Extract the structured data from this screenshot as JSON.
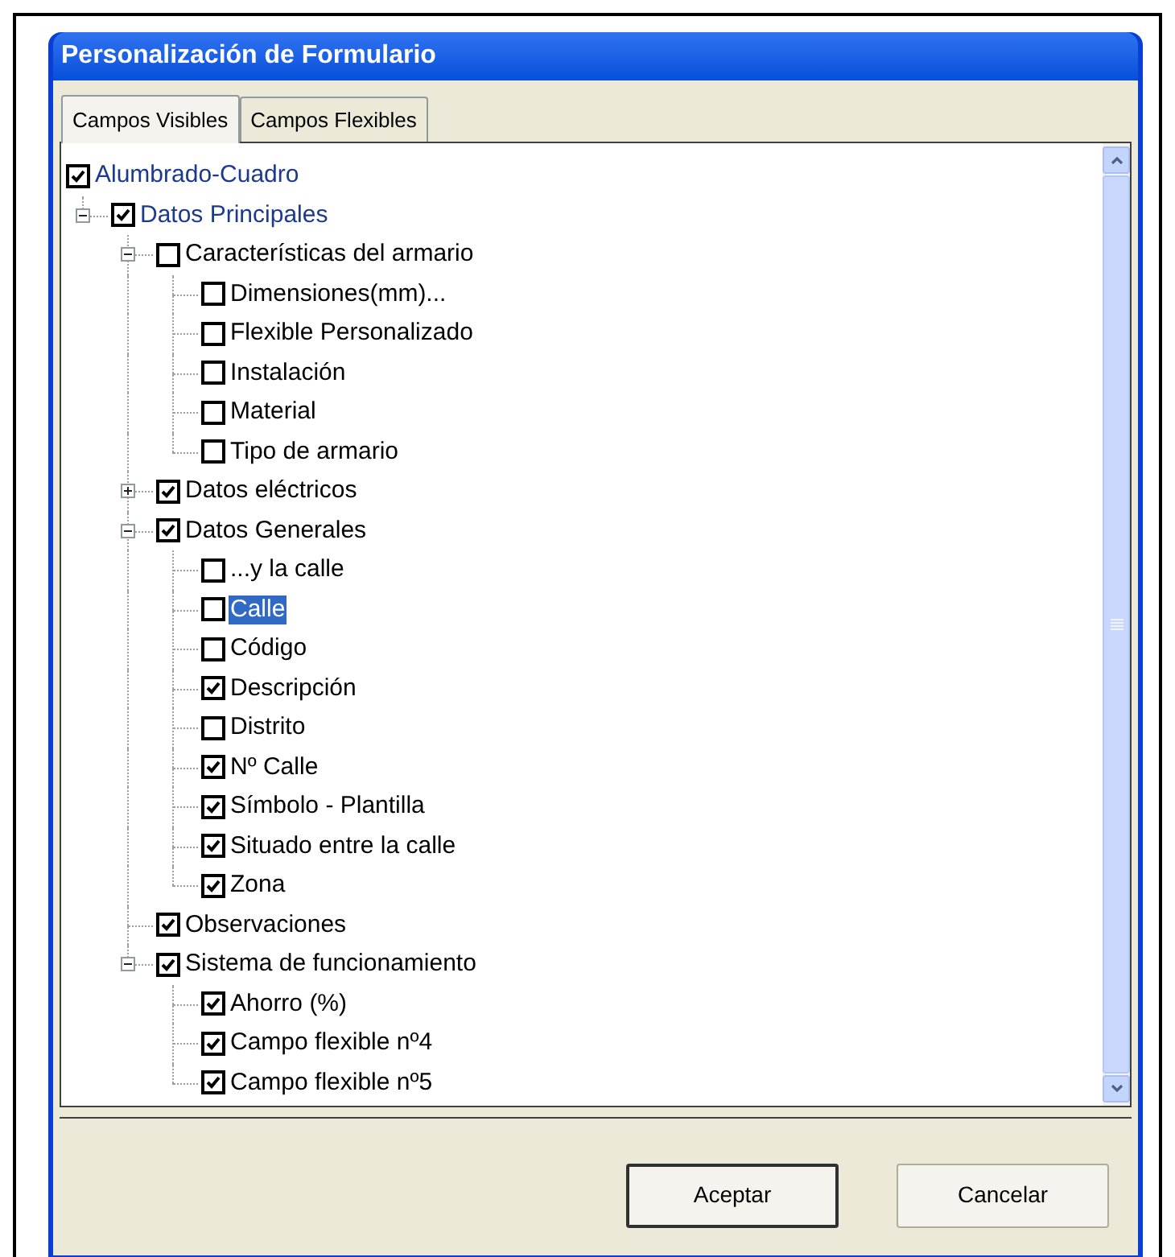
{
  "window": {
    "title": "Personalización de Formulario"
  },
  "tabs": [
    {
      "label": "Campos Visibles",
      "selected": true
    },
    {
      "label": "Campos Flexibles",
      "selected": false
    }
  ],
  "tree": [
    {
      "label": "Alumbrado-Cuadro",
      "checked": true,
      "selected": false,
      "color": "#1c3a8c",
      "children": [
        {
          "label": "Datos Principales",
          "checked": true,
          "selected": false,
          "color": "#1c3a8c",
          "expanded": true,
          "children": [
            {
              "label": "Características del armario",
              "checked": false,
              "selected": false,
              "color": "#000000",
              "expanded": true,
              "children": [
                {
                  "label": "Dimensiones(mm)...",
                  "checked": false,
                  "selected": false,
                  "color": "#000000"
                },
                {
                  "label": "Flexible Personalizado",
                  "checked": false,
                  "selected": false,
                  "color": "#000000"
                },
                {
                  "label": "Instalación",
                  "checked": false,
                  "selected": false,
                  "color": "#000000"
                },
                {
                  "label": "Material",
                  "checked": false,
                  "selected": false,
                  "color": "#000000"
                },
                {
                  "label": "Tipo de armario",
                  "checked": false,
                  "selected": false,
                  "color": "#000000"
                }
              ]
            },
            {
              "label": "Datos eléctricos",
              "checked": true,
              "selected": false,
              "color": "#000000",
              "expanded": false
            },
            {
              "label": "Datos Generales",
              "checked": true,
              "selected": false,
              "color": "#000000",
              "expanded": true,
              "children": [
                {
                  "label": "...y la calle",
                  "checked": false,
                  "selected": false,
                  "color": "#000000"
                },
                {
                  "label": "Calle",
                  "checked": false,
                  "selected": true
                },
                {
                  "label": "Código",
                  "checked": false,
                  "selected": false,
                  "color": "#000000"
                },
                {
                  "label": "Descripción",
                  "checked": true,
                  "selected": false,
                  "color": "#000000"
                },
                {
                  "label": "Distrito",
                  "checked": false,
                  "selected": false,
                  "color": "#000000"
                },
                {
                  "label": "Nº Calle",
                  "checked": true,
                  "selected": false,
                  "color": "#000000"
                },
                {
                  "label": "Símbolo - Plantilla",
                  "checked": true,
                  "selected": false,
                  "color": "#000000"
                },
                {
                  "label": "Situado entre la calle",
                  "checked": true,
                  "selected": false,
                  "color": "#000000"
                },
                {
                  "label": "Zona",
                  "checked": true,
                  "selected": false,
                  "color": "#000000"
                }
              ]
            },
            {
              "label": "Observaciones",
              "checked": true,
              "selected": false,
              "color": "#000000"
            },
            {
              "label": "Sistema de funcionamiento",
              "checked": true,
              "selected": false,
              "color": "#000000",
              "expanded": true,
              "children": [
                {
                  "label": "Ahorro (%)",
                  "checked": true,
                  "selected": false,
                  "color": "#000000"
                },
                {
                  "label": "Campo flexible nº4",
                  "checked": true,
                  "selected": false,
                  "color": "#000000"
                },
                {
                  "label": "Campo flexible nº5",
                  "checked": true,
                  "selected": false,
                  "color": "#000000"
                }
              ]
            }
          ]
        }
      ]
    }
  ],
  "buttons": [
    {
      "label": "Aceptar",
      "kind": "default"
    },
    {
      "label": "Cancelar",
      "kind": "normal"
    }
  ]
}
